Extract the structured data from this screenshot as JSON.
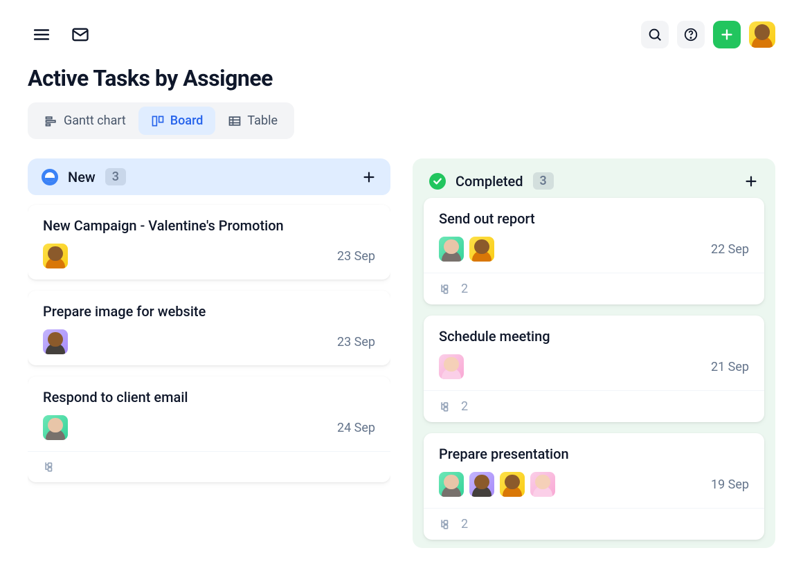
{
  "header": {
    "title": "Active Tasks by Assignee"
  },
  "viewTabs": {
    "gantt": "Gantt chart",
    "board": "Board",
    "table": "Table"
  },
  "columns": {
    "new": {
      "title": "New",
      "count": "3",
      "cards": [
        {
          "title": "New Campaign - Valentine's Promotion",
          "date": "23 Sep",
          "assignees": [
            "yellow"
          ]
        },
        {
          "title": "Prepare image for website",
          "date": "23 Sep",
          "assignees": [
            "purple"
          ]
        },
        {
          "title": "Respond to client email",
          "date": "24 Sep",
          "assignees": [
            "green"
          ],
          "subtasks": ""
        }
      ]
    },
    "completed": {
      "title": "Completed",
      "count": "3",
      "cards": [
        {
          "title": "Send out report",
          "date": "22 Sep",
          "assignees": [
            "green",
            "yellow"
          ],
          "subtasks": "2"
        },
        {
          "title": "Schedule meeting",
          "date": "21 Sep",
          "assignees": [
            "pink"
          ],
          "subtasks": "2"
        },
        {
          "title": "Prepare presentation",
          "date": "19 Sep",
          "assignees": [
            "green",
            "purple",
            "yellow",
            "pink"
          ],
          "subtasks": "2"
        }
      ]
    }
  }
}
